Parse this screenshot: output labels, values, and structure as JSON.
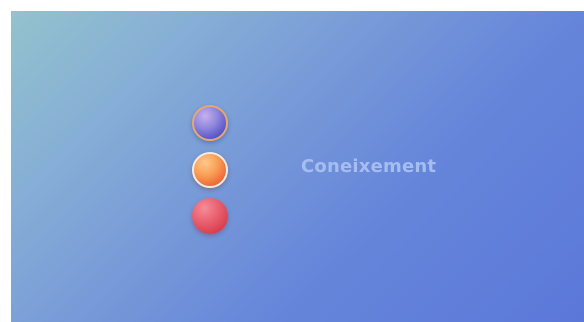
{
  "label": "Coneixement",
  "orbs": [
    {
      "name": "purple",
      "color": "#6f6ad4",
      "border": "#e6a86e"
    },
    {
      "name": "orange",
      "color": "#f5874a",
      "border": "#f1ece4"
    },
    {
      "name": "red",
      "color": "#e0505f"
    }
  ],
  "colors": {
    "background_start": "#94c2cd",
    "background_end": "#5b78d9",
    "label": "#a6bdf0"
  }
}
